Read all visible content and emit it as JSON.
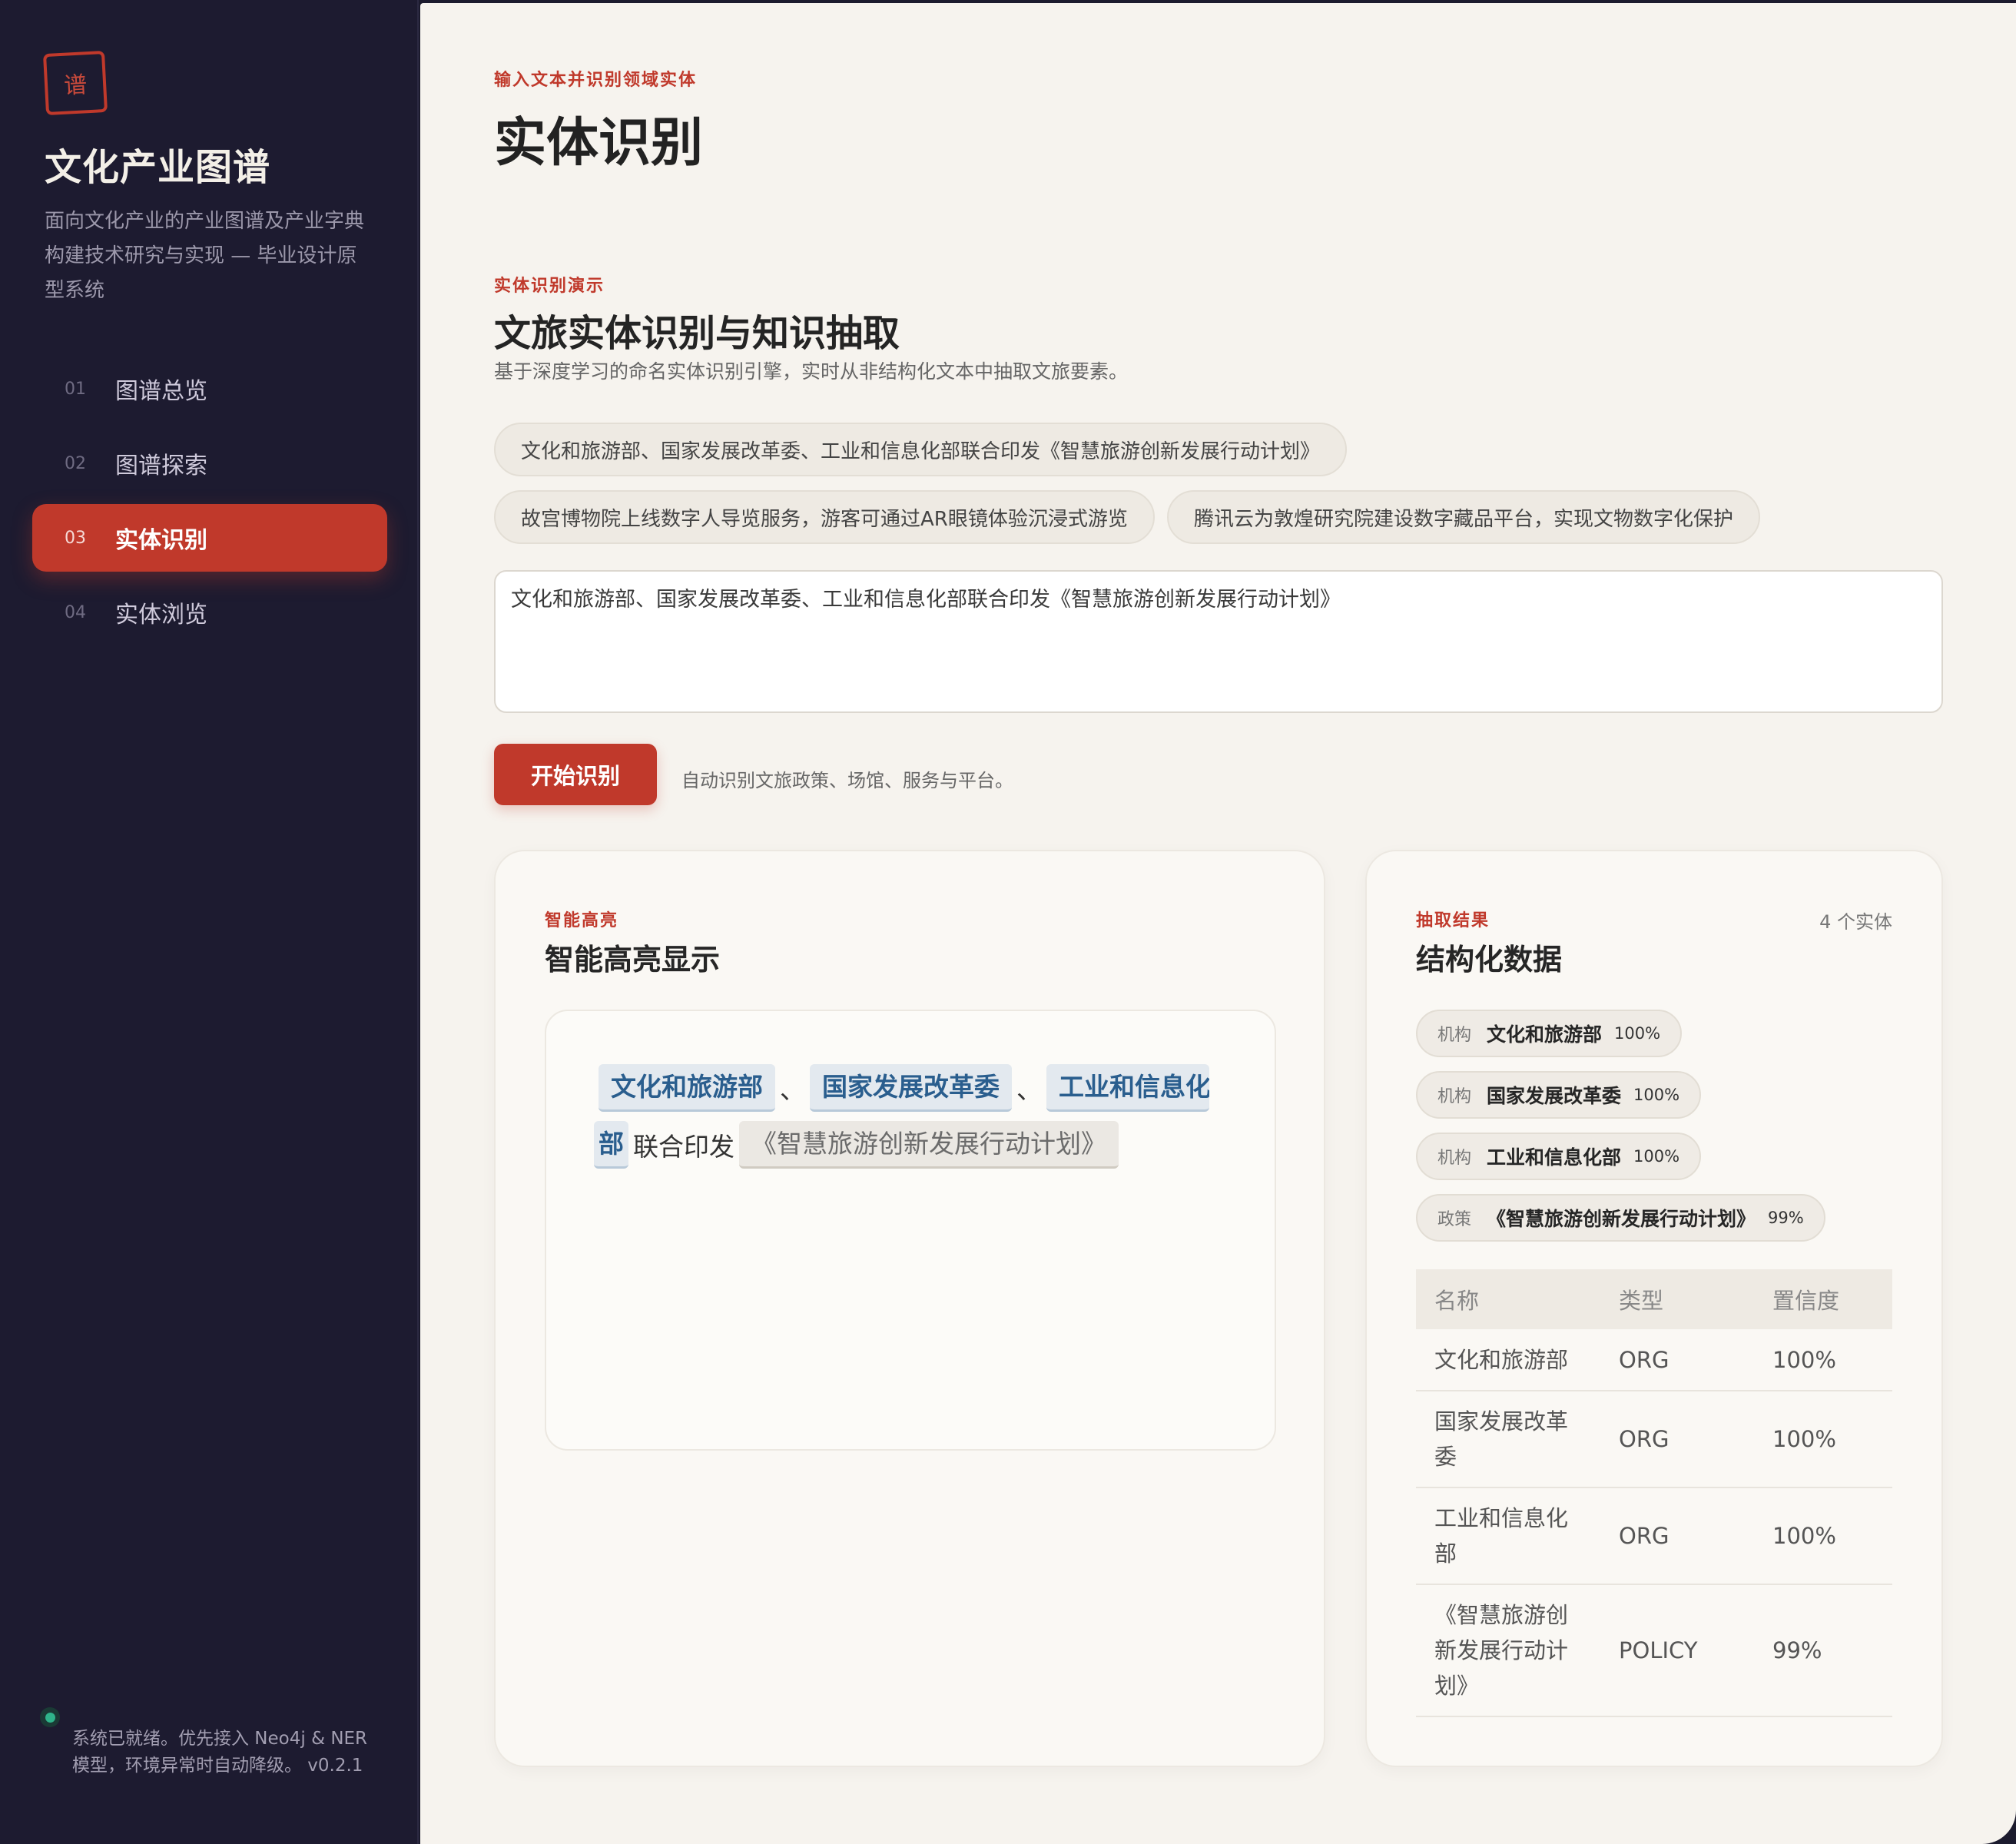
{
  "sidebar": {
    "logo_char": "谱",
    "title": "文化产业图谱",
    "description": "面向文化产业的产业图谱及产业字典构建技术研究与实现 — 毕业设计原型系统",
    "nav": [
      {
        "num": "01",
        "label": "图谱总览",
        "active": false
      },
      {
        "num": "02",
        "label": "图谱探索",
        "active": false
      },
      {
        "num": "03",
        "label": "实体识别",
        "active": true
      },
      {
        "num": "04",
        "label": "实体浏览",
        "active": false
      }
    ],
    "status": "系统已就绪。优先接入 Neo4j & NER 模型，环境异常时自动降级。 v0.2.1",
    "status_color": "#2fb38a"
  },
  "header": {
    "eyebrow": "输入文本并识别领域实体",
    "title": "实体识别"
  },
  "demo": {
    "eyebrow": "实体识别演示",
    "title": "文旅实体识别与知识抽取",
    "description": "基于深度学习的命名实体识别引擎，实时从非结构化文本中抽取文旅要素。",
    "examples": [
      "文化和旅游部、国家发展改革委、工业和信息化部联合印发《智慧旅游创新发展行动计划》",
      "故宫博物院上线数字人导览服务，游客可通过AR眼镜体验沉浸式游览",
      "腾讯云为敦煌研究院建设数字藏品平台，实现文物数字化保护"
    ],
    "input_value": "文化和旅游部、国家发展改革委、工业和信息化部联合印发《智慧旅游创新发展行动计划》",
    "button_label": "开始识别",
    "button_hint": "自动识别文旅政策、场馆、服务与平台。"
  },
  "highlight": {
    "eyebrow": "智能高亮",
    "title": "智能高亮显示",
    "line1": [
      {
        "text": "文化和旅游部",
        "kind": "org"
      },
      {
        "text": "、",
        "kind": "plain"
      },
      {
        "text": "国家发展改革委",
        "kind": "org"
      },
      {
        "text": "、",
        "kind": "plain"
      },
      {
        "text": "工业和信息化",
        "kind": "org"
      }
    ],
    "line2": [
      {
        "text": "部",
        "kind": "org"
      },
      {
        "text": "联合印发",
        "kind": "plain"
      },
      {
        "text": "《智慧旅游创新发展行动计划》",
        "kind": "policy"
      }
    ]
  },
  "results": {
    "eyebrow": "抽取结果",
    "title": "结构化数据",
    "count": "4 个实体",
    "tags": [
      {
        "type": "机构",
        "name": "文化和旅游部",
        "conf": "100%"
      },
      {
        "type": "机构",
        "name": "国家发展改革委",
        "conf": "100%"
      },
      {
        "type": "机构",
        "name": "工业和信息化部",
        "conf": "100%"
      },
      {
        "type": "政策",
        "name": "《智慧旅游创新发展行动计划》",
        "conf": "99%"
      }
    ],
    "table": {
      "headers": [
        "名称",
        "类型",
        "置信度"
      ],
      "rows": [
        {
          "name": "文化和旅游部",
          "type": "ORG",
          "conf": "100%"
        },
        {
          "name": "国家发展改革委",
          "type": "ORG",
          "conf": "100%"
        },
        {
          "name": "工业和信息化部",
          "type": "ORG",
          "conf": "100%"
        },
        {
          "name": "《智慧旅游创新发展行动计划》",
          "type": "POLICY",
          "conf": "99%"
        }
      ]
    }
  },
  "colors": {
    "accent": "#c0392b",
    "sidebar_bg": "#1d1b30",
    "main_bg": "#f6f3ee",
    "org_text": "#2a5e8e"
  }
}
